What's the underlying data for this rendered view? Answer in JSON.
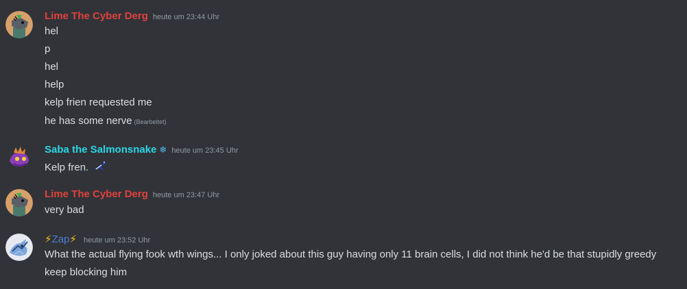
{
  "messages": [
    {
      "username": "Lime The Cyber Derg",
      "timestamp": "heute um 23:44 Uhr",
      "lines": [
        "hel",
        "p",
        "hel",
        "help",
        "kelp frien requested me",
        "he has some nerve"
      ],
      "edited_label": "(Bearbeitet)"
    },
    {
      "username": "Saba the Salmonsnake",
      "badge_icon": "❄",
      "timestamp": "heute um 23:45 Uhr",
      "lines": [
        "Kelp fren."
      ],
      "custom_emoji": "kelp-emoji-icon"
    },
    {
      "username": "Lime The Cyber Derg",
      "timestamp": "heute um 23:47 Uhr",
      "lines": [
        "very bad"
      ]
    },
    {
      "username_prefix": "⚡",
      "username": "Zap",
      "username_suffix": "⚡",
      "timestamp": "heute um 23:52 Uhr",
      "lines": [
        "What the actual flying fook wth wings... I only joked about this guy having only 11 brain cells, I did not think he'd be that stupidly greedy",
        "keep blocking him"
      ]
    }
  ],
  "colors": {
    "background": "#313338",
    "text": "#dbdee1",
    "muted": "#949ba4",
    "lime_name": "#e0423c",
    "saba_name": "#2bd6e4",
    "zap_name": "#4c7dd6"
  }
}
